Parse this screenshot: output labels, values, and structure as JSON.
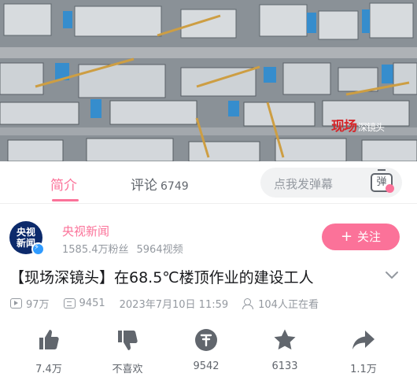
{
  "video": {
    "watermark_main": "现场",
    "watermark_sub": "深镜头"
  },
  "tabs": {
    "intro": "简介",
    "comments": "评论",
    "comments_count": "6749",
    "danmaku_placeholder": "点我发弹幕",
    "danmaku_toggle": "弹"
  },
  "uploader": {
    "avatar_text_1": "央视",
    "avatar_text_2": "新闻",
    "name": "央视新闻",
    "fans": "1585.4万粉丝",
    "videos": "5964视频",
    "follow_label": "关注",
    "follow_icon": "plus-icon"
  },
  "video_info": {
    "title": "【现场深镜头】在68.5℃楼顶作业的建设工人",
    "views": "97万",
    "danmaku": "9451",
    "date": "2023年7月10日 11:59",
    "watching": "104人正在看"
  },
  "actions": [
    {
      "icon": "thumbs-up-icon",
      "label": "7.4万"
    },
    {
      "icon": "thumbs-down-icon",
      "label": "不喜欢"
    },
    {
      "icon": "coin-icon",
      "label": "9542"
    },
    {
      "icon": "star-icon",
      "label": "6133"
    },
    {
      "icon": "share-icon",
      "label": "1.1万"
    }
  ],
  "colors": {
    "accent": "#fb7299",
    "text_primary": "#18191c",
    "text_secondary": "#9499a0",
    "icon": "#61666d"
  }
}
